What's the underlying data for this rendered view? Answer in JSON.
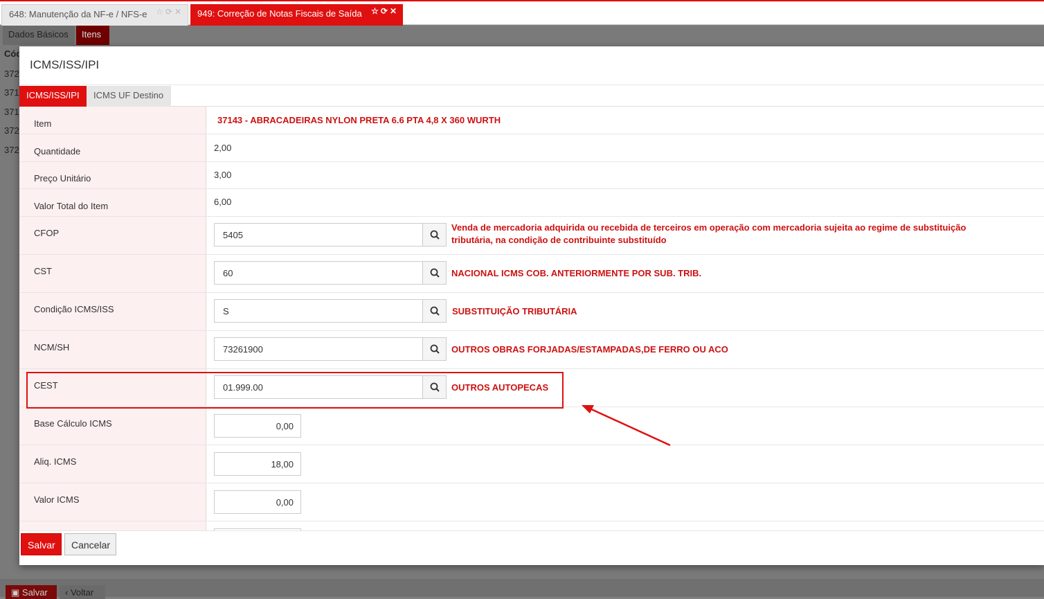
{
  "top_tabs": [
    {
      "label": "648: Manutenção da NF-e / NFS-e"
    },
    {
      "label": "949: Correção de Notas Fiscais de Saída"
    }
  ],
  "icons": {
    "favorite": "star-icon",
    "refresh": "refresh-icon",
    "close": "close-icon",
    "search": "search-icon"
  },
  "sub_tabs": [
    "Dados Básicos",
    "Itens"
  ],
  "background_column": {
    "header": "Cód",
    "cells": [
      "372",
      "371",
      "371",
      "372",
      "372"
    ]
  },
  "background_footer": {
    "save": "Salvar",
    "back": "Voltar"
  },
  "modal": {
    "title": "ICMS/ISS/IPI",
    "tabs": [
      "ICMS/ISS/IPI",
      "ICMS UF Destino"
    ],
    "fields": {
      "item": {
        "label": "Item",
        "value": "37143 - ABRACADEIRAS NYLON PRETA 6.6 PTA 4,8 X 360 WURTH"
      },
      "quantidade": {
        "label": "Quantidade",
        "value": "2,00"
      },
      "preco": {
        "label": "Preço Unitário",
        "value": "3,00"
      },
      "total": {
        "label": "Valor Total do Item",
        "value": "6,00"
      },
      "cfop": {
        "label": "CFOP",
        "value": "5405",
        "desc_line1": "Venda de mercadoria adquirida ou recebida de terceiros em operação com mercadoria sujeita ao regime de substituição",
        "desc_line2": "tributária, na condição de contribuinte substituído"
      },
      "cst": {
        "label": "CST",
        "value": "60",
        "desc": "NACIONAL ICMS COB. ANTERIORMENTE POR SUB. TRIB."
      },
      "condicao": {
        "label": "Condição ICMS/ISS",
        "value": "S",
        "desc": "SUBSTITUIÇÃO TRIBUTÁRIA"
      },
      "ncm": {
        "label": "NCM/SH",
        "value": "73261900",
        "desc": "OUTROS OBRAS FORJADAS/ESTAMPADAS,DE FERRO OU ACO"
      },
      "cest": {
        "label": "CEST",
        "value": "01.999.00",
        "desc": "OUTROS AUTOPECAS"
      },
      "base_icms": {
        "label": "Base Cálculo ICMS",
        "value": "0,00"
      },
      "aliq_icms": {
        "label": "Aliq. ICMS",
        "value": "18,00"
      },
      "valor_icms": {
        "label": "Valor ICMS",
        "value": "0,00"
      }
    },
    "footer": {
      "save": "Salvar",
      "cancel": "Cancelar"
    }
  },
  "colors": {
    "accent": "#e01010",
    "label_bg": "#fdf0f0",
    "desc_text": "#cc1111"
  }
}
